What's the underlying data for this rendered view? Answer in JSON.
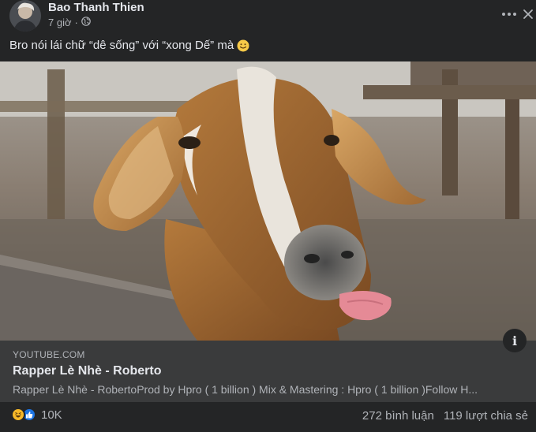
{
  "post": {
    "author": "Bao Thanh Thien",
    "time": "7 giờ",
    "separator": "·",
    "audience_icon": "globe-icon",
    "caption": "Bro nói lái chữ “dê sống” với “xong Dế” mà",
    "caption_emoji": "slightly-smiling-face-emoji"
  },
  "link_preview": {
    "domain": "YOUTUBE.COM",
    "title": "Rapper Lè Nhè - Roberto",
    "description": "Rapper Lè Nhè - RobertoProd by Hpro ( 1 billion ) Mix & Mastering : Hpro ( 1 billion )Follow H...",
    "info_symbol": "i"
  },
  "footer": {
    "reactions_count": "10K",
    "comments": "272 bình luận",
    "shares": "119 lượt chia sẻ"
  },
  "colors": {
    "background": "#242526",
    "link_bg": "#3a3b3c",
    "primary_text": "#e4e6eb",
    "secondary_text": "#b0b3b8",
    "like_blue": "#1b74e4",
    "haha_yellow": "#f7b928"
  }
}
